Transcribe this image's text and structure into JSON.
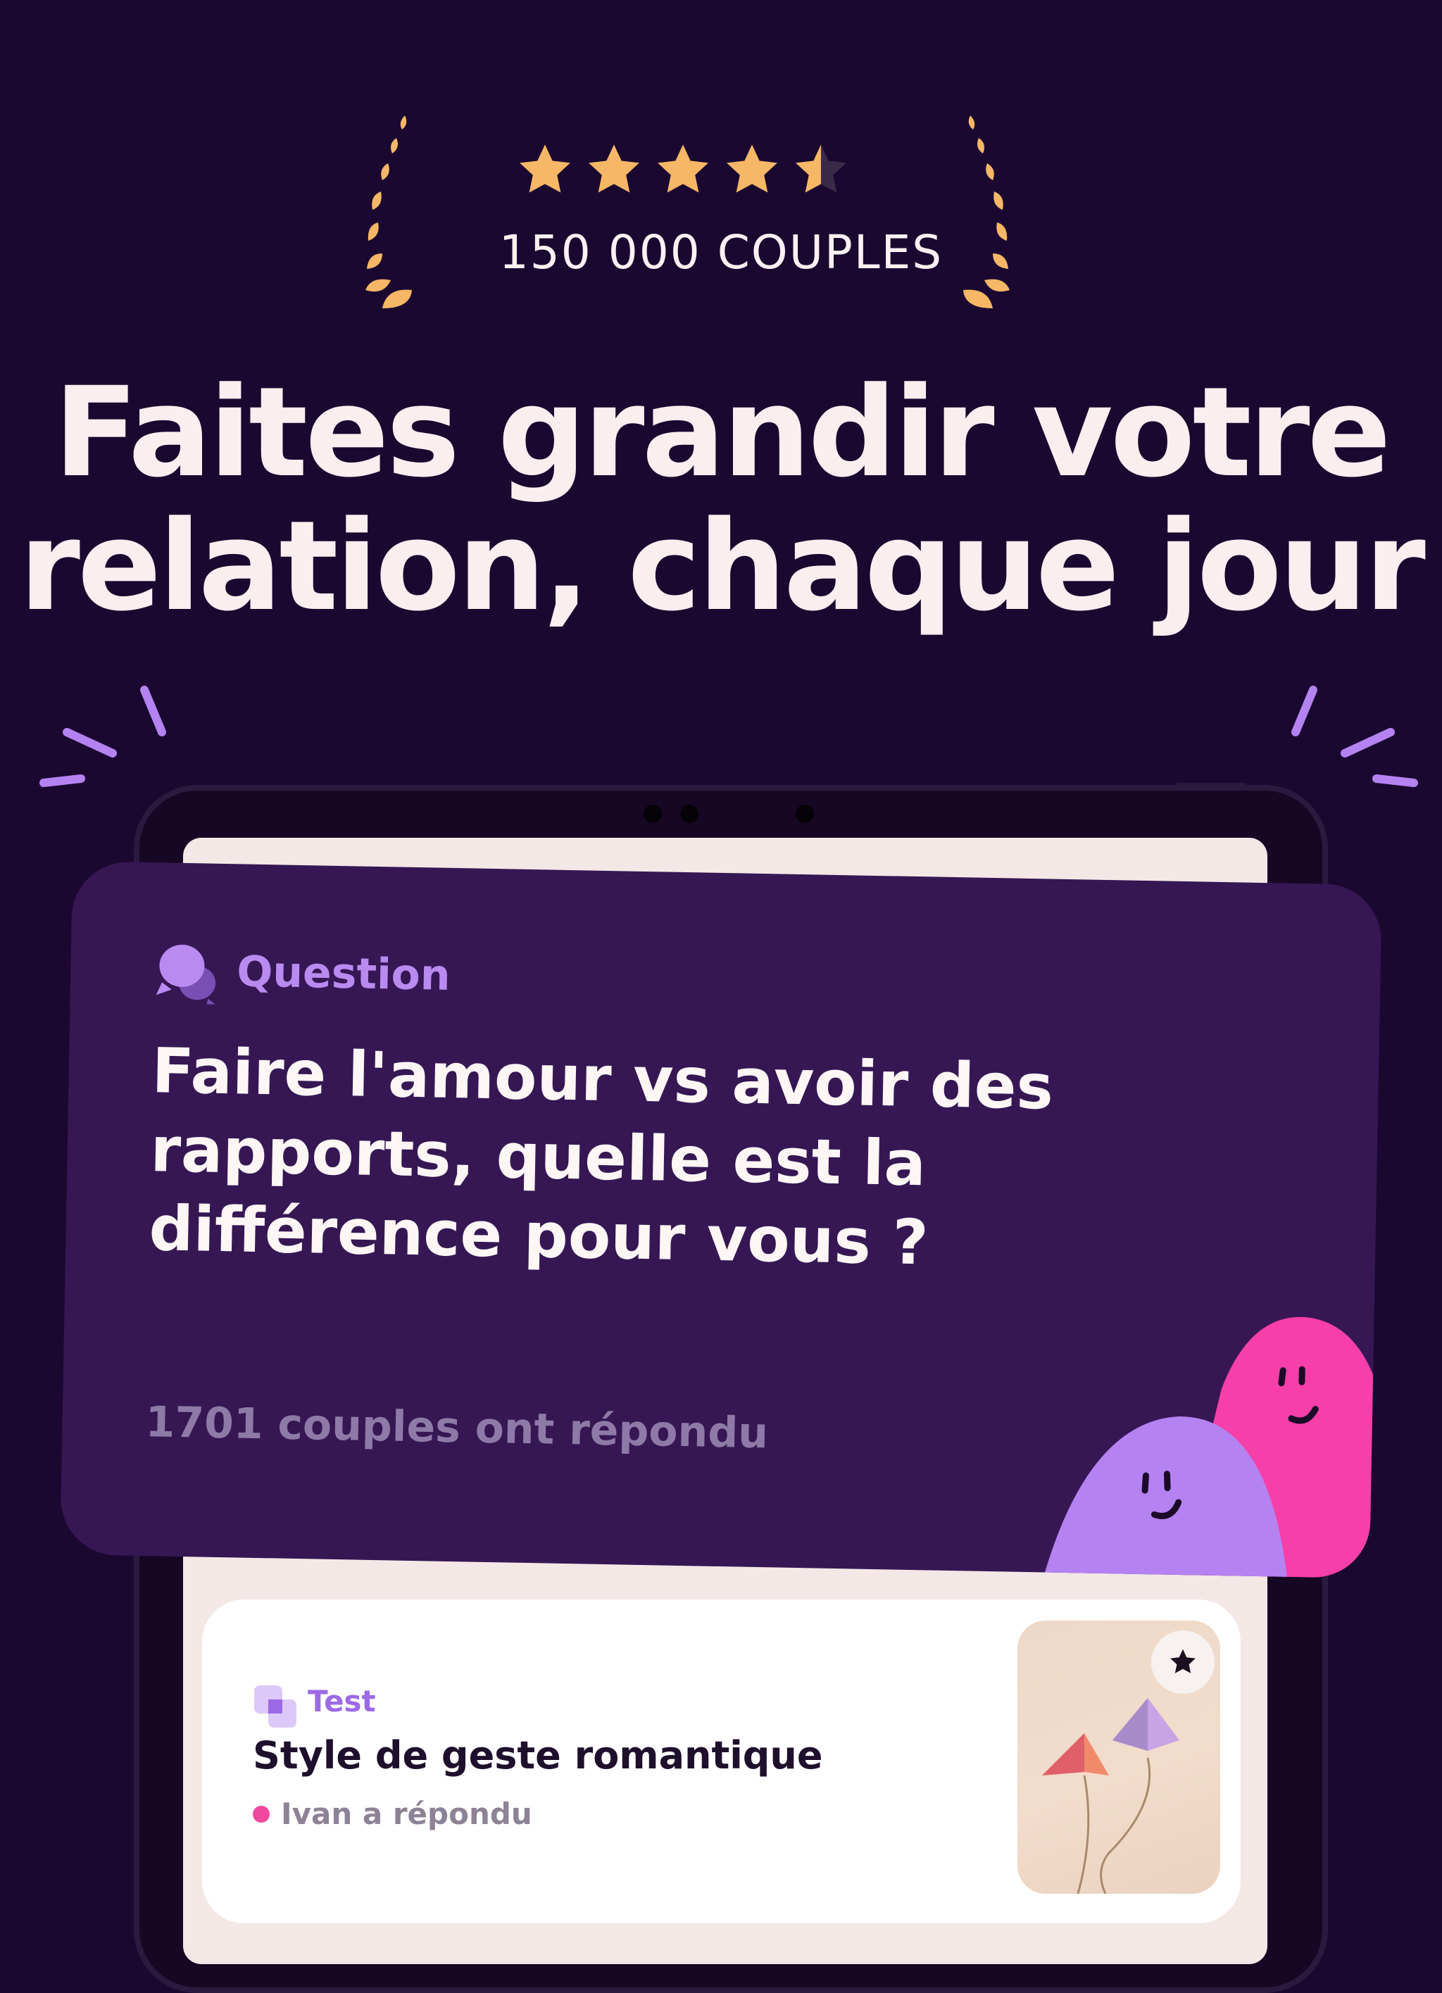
{
  "rating": {
    "stars": 4.5,
    "label": "150 000 COUPLES",
    "star_color": "#f6b766",
    "laurel_color": "#f6b766"
  },
  "headline": {
    "line1": "Faites grandir votre",
    "line2": "relation, chaque jour"
  },
  "question_card": {
    "icon": "chat-bubbles-icon",
    "tag": "Question",
    "text": "Faire l'amour vs avoir des rapports, quelle est la différence pour vous ?",
    "answered": "1701 couples ont répondu",
    "background": "#361754"
  },
  "test_card": {
    "icon": "stacked-squares-icon",
    "tag": "Test",
    "title": "Style de geste romantique",
    "status": "Ivan a répondu",
    "favorite_icon": "star-icon",
    "image_icon": "paper-kites-icon"
  },
  "colors": {
    "background": "#1a0830",
    "accent_purple": "#b582f2",
    "accent_pink": "#f63fa8"
  }
}
